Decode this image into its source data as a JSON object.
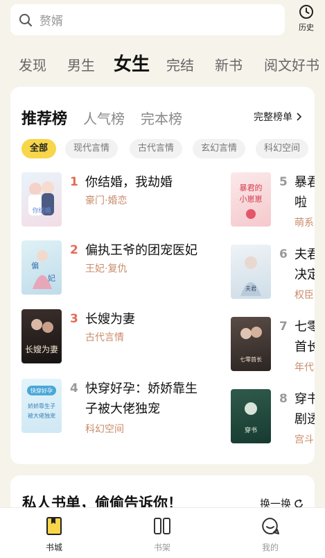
{
  "search": {
    "placeholder": "赘婿",
    "icon": "search-icon"
  },
  "history": {
    "label": "历史",
    "icon": "clock-icon"
  },
  "category_tabs": [
    {
      "label": "发现",
      "active": false
    },
    {
      "label": "男生",
      "active": false
    },
    {
      "label": "女生",
      "active": true
    },
    {
      "label": "完结",
      "active": false
    },
    {
      "label": "新书",
      "active": false
    },
    {
      "label": "阅文好书",
      "active": false
    }
  ],
  "ranking": {
    "tabs": [
      {
        "label": "推荐榜",
        "active": true
      },
      {
        "label": "人气榜",
        "active": false
      },
      {
        "label": "完本榜",
        "active": false
      }
    ],
    "full_list_label": "完整榜单",
    "chips": [
      {
        "label": "全部",
        "active": true
      },
      {
        "label": "现代言情",
        "active": false
      },
      {
        "label": "古代言情",
        "active": false
      },
      {
        "label": "玄幻言情",
        "active": false
      },
      {
        "label": "科幻空间",
        "active": false
      }
    ],
    "books": [
      {
        "rank": "1",
        "title_line1": "你结婚，我劫婚",
        "title_line2": "",
        "tag": "豪门·婚恋",
        "cover_text": "你结婚我劫婚"
      },
      {
        "rank": "2",
        "title_line1": "偏执王爷的团宠医妃",
        "title_line2": "",
        "tag": "王妃·复仇",
        "cover_text": "偏执王爷的团宠医妃"
      },
      {
        "rank": "3",
        "title_line1": "长嫂为妻",
        "title_line2": "",
        "tag": "古代言情",
        "cover_text": "长嫂为妻"
      },
      {
        "rank": "4",
        "title_line1": "快穿好孕：娇娇靠生",
        "title_line2": "子被大佬独宠",
        "tag": "科幻空间",
        "cover_text": "快穿好孕"
      },
      {
        "rank": "5",
        "title_line1": "暴君",
        "title_line2": "啦",
        "tag": "萌系",
        "cover_text": "暴君的小崽崽"
      },
      {
        "rank": "6",
        "title_line1": "夫君",
        "title_line2": "决定",
        "tag": "权臣",
        "cover_text": "夫君"
      },
      {
        "rank": "7",
        "title_line1": "七零",
        "title_line2": "首长",
        "tag": "年代",
        "cover_text": "七零首长"
      },
      {
        "rank": "8",
        "title_line1": "穿书",
        "title_line2": "剧透",
        "tag": "宫斗",
        "cover_text": "穿书"
      }
    ]
  },
  "private_list": {
    "heading": "私人书单，偷偷告诉你！",
    "refresh_label": "换一换"
  },
  "bottom_nav": [
    {
      "label": "书城",
      "icon": "bookstore-icon",
      "active": true
    },
    {
      "label": "书架",
      "icon": "bookshelf-icon",
      "active": false
    },
    {
      "label": "我的",
      "icon": "profile-icon",
      "active": false
    }
  ],
  "colors": {
    "accent": "#f7d64a",
    "rank_top": "#e36b55",
    "rank_other": "#999999",
    "tag": "#c98b6a",
    "background": "#f6f3ea"
  }
}
